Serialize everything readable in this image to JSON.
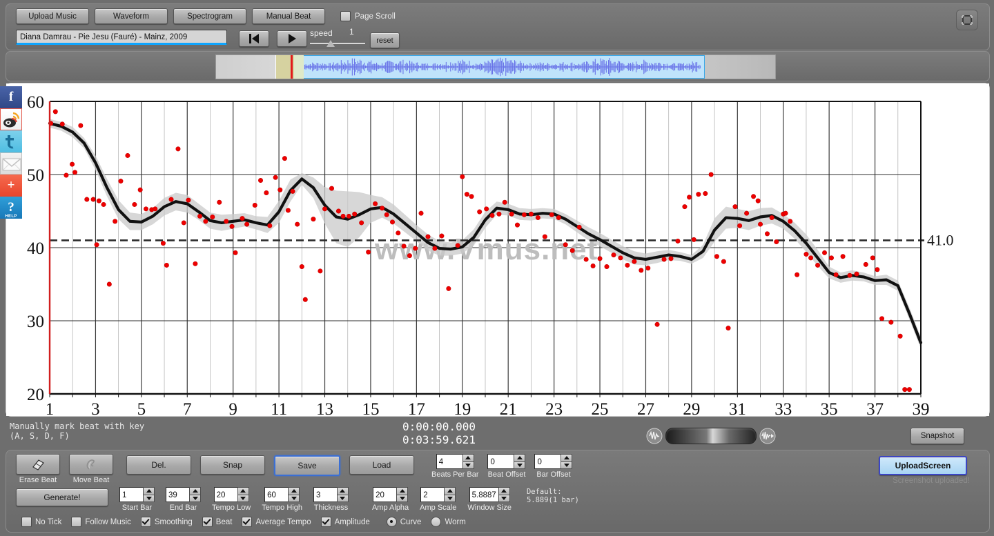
{
  "toolbar": {
    "buttons": [
      {
        "id": "upload-music",
        "label": "Upload Music"
      },
      {
        "id": "waveform",
        "label": "Waveform"
      },
      {
        "id": "spectrogram",
        "label": "Spectrogram"
      },
      {
        "id": "manual-beat",
        "label": "Manual Beat"
      }
    ],
    "page_scroll_label": "Page Scroll",
    "page_scroll_checked": false,
    "track_title": "Diana Damrau - Pie Jesu (Fauré) - Mainz, 2009",
    "speed_label": "speed",
    "speed_value": "1",
    "reset_label": "reset",
    "reload_icon": "reload-icon"
  },
  "social": [
    {
      "id": "facebook",
      "glyph": "f",
      "name": "facebook-icon"
    },
    {
      "id": "weibo",
      "glyph": "",
      "name": "weibo-icon"
    },
    {
      "id": "twitter",
      "glyph": "t",
      "name": "twitter-icon"
    },
    {
      "id": "email",
      "glyph": "",
      "name": "email-icon"
    },
    {
      "id": "share",
      "glyph": "+",
      "name": "plus-share-icon"
    },
    {
      "id": "help",
      "glyph": "?",
      "name": "help-icon",
      "caption": "HELP"
    }
  ],
  "chart_data": {
    "type": "line",
    "title": "",
    "xlabel": "",
    "ylabel": "",
    "watermark": "www.Vmus.net",
    "xlim": [
      1,
      39
    ],
    "ylim": [
      20,
      60
    ],
    "grid": true,
    "xticks": [
      1,
      3,
      5,
      7,
      9,
      11,
      13,
      15,
      17,
      19,
      21,
      23,
      25,
      27,
      29,
      31,
      33,
      35,
      37,
      39
    ],
    "yticks": [
      20,
      30,
      40,
      50,
      60
    ],
    "average_tempo": 41.0,
    "average_tempo_label": "41.0",
    "series": [
      {
        "name": "smoothed tempo curve",
        "color": "#111111",
        "x": [
          1,
          1.5,
          2,
          2.5,
          3,
          3.5,
          4,
          4.5,
          5,
          5.5,
          6,
          6.5,
          7,
          7.5,
          8,
          8.5,
          9,
          9.5,
          10,
          10.5,
          11,
          11.5,
          12,
          12.5,
          13,
          13.5,
          14,
          14.5,
          15,
          15.5,
          16,
          16.5,
          17,
          17.5,
          18,
          18.5,
          19,
          19.5,
          20,
          20.5,
          21,
          21.5,
          22,
          22.5,
          23,
          23.5,
          24,
          24.5,
          25,
          25.5,
          26,
          26.5,
          27,
          27.5,
          28,
          28.5,
          29,
          29.5,
          30,
          30.5,
          31,
          31.5,
          32,
          32.5,
          33,
          33.5,
          34,
          34.5,
          35,
          35.5,
          36,
          36.5,
          37,
          37.5,
          38,
          38.5,
          39
        ],
        "y": [
          57.0,
          56.6,
          55.8,
          54.3,
          51.6,
          48.2,
          45.2,
          43.6,
          43.5,
          44.3,
          45.6,
          46.3,
          46.0,
          44.9,
          43.7,
          43.4,
          43.6,
          43.8,
          43.4,
          43.1,
          44.9,
          47.8,
          49.4,
          48.2,
          45.8,
          44.2,
          43.9,
          44.5,
          45.3,
          45.5,
          44.6,
          43.3,
          42.0,
          40.7,
          39.9,
          39.8,
          40.1,
          41.4,
          43.8,
          45.4,
          45.2,
          44.6,
          44.5,
          44.7,
          44.6,
          43.9,
          42.9,
          41.9,
          41.1,
          40.2,
          39.3,
          38.6,
          38.4,
          38.7,
          39.0,
          38.8,
          38.4,
          39.5,
          42.4,
          44.1,
          44.0,
          43.7,
          44.2,
          44.4,
          43.6,
          42.3,
          40.6,
          38.6,
          36.6,
          35.9,
          36.2,
          36.0,
          35.5,
          35.6,
          34.8,
          31.0,
          27.0
        ]
      },
      {
        "name": "confidence band upper",
        "color": "#c9c9c9",
        "y": [
          57.6,
          57.2,
          56.5,
          55.0,
          52.6,
          49.4,
          46.5,
          44.8,
          44.6,
          45.4,
          46.8,
          47.5,
          47.2,
          46.0,
          44.8,
          44.5,
          44.6,
          44.7,
          44.3,
          44.2,
          46.4,
          49.3,
          50.2,
          49.6,
          48.3,
          47.8,
          47.7,
          47.6,
          47.2,
          46.9,
          45.9,
          44.5,
          43.1,
          41.8,
          40.9,
          40.7,
          41.0,
          42.5,
          44.9,
          46.3,
          46.0,
          45.4,
          45.3,
          45.4,
          45.3,
          44.6,
          43.7,
          42.8,
          42.0,
          41.1,
          40.2,
          39.5,
          39.2,
          39.5,
          39.7,
          39.4,
          39.0,
          40.4,
          44.0,
          45.6,
          45.3,
          45.0,
          45.4,
          45.5,
          44.6,
          43.4,
          41.8,
          39.7,
          37.4,
          36.6,
          36.9,
          36.6,
          36.1,
          36.3,
          35.5,
          31.8,
          27.8
        ]
      },
      {
        "name": "confidence band lower",
        "color": "#c9c9c9",
        "y": [
          56.4,
          56.0,
          55.1,
          53.6,
          50.6,
          47.0,
          43.9,
          42.4,
          42.4,
          43.2,
          44.4,
          45.1,
          44.8,
          43.8,
          42.6,
          42.3,
          42.6,
          42.9,
          42.5,
          42.0,
          43.4,
          46.3,
          48.6,
          46.8,
          43.3,
          40.6,
          40.1,
          41.4,
          43.4,
          44.1,
          43.3,
          42.1,
          40.9,
          39.6,
          38.9,
          38.9,
          39.2,
          40.3,
          42.7,
          44.5,
          44.4,
          43.8,
          43.7,
          44.0,
          43.9,
          43.2,
          42.1,
          41.0,
          40.2,
          39.3,
          38.4,
          37.7,
          37.6,
          37.9,
          38.3,
          38.2,
          37.8,
          38.6,
          40.8,
          42.6,
          42.7,
          42.4,
          43.0,
          43.3,
          42.6,
          41.2,
          39.4,
          37.5,
          35.8,
          35.2,
          35.5,
          35.4,
          34.9,
          34.9,
          34.1,
          30.2,
          26.2
        ]
      }
    ],
    "scatter": {
      "name": "beat tempo points",
      "color": "#ee0000",
      "points": [
        [
          1.05,
          57.0
        ],
        [
          1.25,
          58.6
        ],
        [
          1.55,
          56.9
        ],
        [
          1.72,
          49.9
        ],
        [
          1.98,
          51.4
        ],
        [
          2.1,
          50.3
        ],
        [
          2.35,
          56.7
        ],
        [
          2.62,
          46.6
        ],
        [
          2.9,
          46.6
        ],
        [
          3.05,
          40.4
        ],
        [
          3.15,
          46.4
        ],
        [
          3.35,
          45.9
        ],
        [
          3.6,
          35.0
        ],
        [
          3.85,
          43.6
        ],
        [
          4.1,
          49.1
        ],
        [
          4.4,
          52.6
        ],
        [
          4.7,
          45.9
        ],
        [
          4.95,
          47.9
        ],
        [
          5.2,
          45.3
        ],
        [
          5.45,
          45.2
        ],
        [
          5.6,
          45.3
        ],
        [
          5.95,
          40.6
        ],
        [
          6.1,
          37.6
        ],
        [
          6.3,
          46.6
        ],
        [
          6.6,
          53.5
        ],
        [
          6.85,
          43.4
        ],
        [
          7.05,
          46.5
        ],
        [
          7.35,
          37.8
        ],
        [
          7.55,
          44.3
        ],
        [
          7.8,
          43.6
        ],
        [
          8.1,
          44.2
        ],
        [
          8.4,
          46.2
        ],
        [
          8.7,
          43.6
        ],
        [
          8.95,
          42.9
        ],
        [
          9.1,
          39.3
        ],
        [
          9.4,
          44.0
        ],
        [
          9.6,
          43.2
        ],
        [
          9.95,
          45.8
        ],
        [
          10.2,
          49.2
        ],
        [
          10.45,
          47.5
        ],
        [
          10.6,
          43.0
        ],
        [
          10.85,
          49.6
        ],
        [
          11.05,
          47.9
        ],
        [
          11.25,
          52.2
        ],
        [
          11.4,
          45.1
        ],
        [
          11.6,
          47.7
        ],
        [
          11.8,
          43.2
        ],
        [
          12.0,
          37.4
        ],
        [
          12.15,
          32.9
        ],
        [
          12.5,
          43.9
        ],
        [
          12.8,
          36.8
        ],
        [
          13.0,
          45.3
        ],
        [
          13.3,
          48.1
        ],
        [
          13.6,
          45.0
        ],
        [
          13.8,
          44.3
        ],
        [
          14.05,
          44.3
        ],
        [
          14.3,
          44.6
        ],
        [
          14.6,
          43.4
        ],
        [
          14.9,
          39.4
        ],
        [
          15.2,
          46.0
        ],
        [
          15.5,
          45.4
        ],
        [
          15.7,
          44.5
        ],
        [
          15.95,
          43.5
        ],
        [
          16.2,
          42.0
        ],
        [
          16.45,
          40.2
        ],
        [
          16.7,
          38.9
        ],
        [
          16.95,
          39.9
        ],
        [
          17.2,
          44.7
        ],
        [
          17.5,
          41.5
        ],
        [
          17.8,
          39.9
        ],
        [
          18.1,
          41.6
        ],
        [
          18.4,
          34.4
        ],
        [
          18.8,
          40.3
        ],
        [
          19.0,
          49.7
        ],
        [
          19.2,
          47.3
        ],
        [
          19.4,
          47.0
        ],
        [
          19.75,
          44.9
        ],
        [
          20.05,
          45.3
        ],
        [
          20.3,
          44.4
        ],
        [
          20.6,
          44.6
        ],
        [
          20.85,
          46.2
        ],
        [
          21.15,
          44.6
        ],
        [
          21.4,
          43.1
        ],
        [
          21.7,
          44.5
        ],
        [
          22.0,
          44.6
        ],
        [
          22.3,
          44.1
        ],
        [
          22.6,
          41.5
        ],
        [
          22.9,
          44.5
        ],
        [
          23.2,
          44.1
        ],
        [
          23.5,
          40.4
        ],
        [
          23.8,
          39.6
        ],
        [
          24.1,
          42.8
        ],
        [
          24.4,
          38.4
        ],
        [
          24.7,
          37.5
        ],
        [
          25.0,
          38.5
        ],
        [
          25.3,
          37.4
        ],
        [
          25.6,
          39.0
        ],
        [
          25.9,
          38.6
        ],
        [
          26.2,
          37.6
        ],
        [
          26.5,
          38.1
        ],
        [
          26.8,
          36.9
        ],
        [
          27.1,
          37.2
        ],
        [
          27.5,
          29.5
        ],
        [
          27.8,
          38.4
        ],
        [
          28.1,
          38.5
        ],
        [
          28.4,
          40.9
        ],
        [
          28.7,
          45.6
        ],
        [
          28.9,
          46.9
        ],
        [
          29.1,
          41.1
        ],
        [
          29.3,
          47.3
        ],
        [
          29.6,
          47.4
        ],
        [
          29.85,
          50.0
        ],
        [
          30.1,
          38.8
        ],
        [
          30.4,
          38.1
        ],
        [
          30.6,
          29.0
        ],
        [
          30.9,
          45.6
        ],
        [
          31.1,
          43.0
        ],
        [
          31.4,
          44.7
        ],
        [
          31.7,
          47.0
        ],
        [
          31.9,
          46.4
        ],
        [
          32.0,
          43.2
        ],
        [
          32.3,
          41.9
        ],
        [
          32.5,
          44.1
        ],
        [
          32.7,
          40.8
        ],
        [
          33.0,
          44.6
        ],
        [
          33.1,
          44.7
        ],
        [
          33.3,
          43.6
        ],
        [
          33.6,
          36.3
        ],
        [
          34.0,
          39.1
        ],
        [
          34.2,
          38.6
        ],
        [
          34.5,
          37.6
        ],
        [
          34.8,
          39.3
        ],
        [
          35.1,
          38.6
        ],
        [
          35.3,
          36.3
        ],
        [
          35.6,
          38.8
        ],
        [
          35.9,
          36.2
        ],
        [
          36.2,
          36.4
        ],
        [
          36.6,
          37.7
        ],
        [
          36.9,
          38.6
        ],
        [
          37.1,
          37.0
        ],
        [
          37.3,
          30.3
        ],
        [
          37.7,
          29.8
        ],
        [
          38.1,
          27.9
        ],
        [
          38.3,
          20.6
        ],
        [
          38.5,
          20.6
        ]
      ]
    }
  },
  "status": {
    "hint_line1": "Manually mark beat with key",
    "hint_line2": "(A, S, D, F)",
    "time_current": "0:00:00.000",
    "time_total": "0:03:59.621",
    "snapshot_label": "Snapshot",
    "volume_name": "volume-slider"
  },
  "bottom": {
    "tools": [
      {
        "id": "erase-beat",
        "icon": "eraser-icon",
        "caption": "Erase Beat"
      },
      {
        "id": "move-beat",
        "icon": "hand-icon",
        "caption": "Move Beat"
      }
    ],
    "actions": [
      {
        "id": "del",
        "label": "Del.",
        "focus": false
      },
      {
        "id": "snap",
        "label": "Snap",
        "focus": false
      },
      {
        "id": "save",
        "label": "Save",
        "focus": true
      },
      {
        "id": "load",
        "label": "Load",
        "focus": false
      }
    ],
    "spinners_row1": [
      {
        "id": "beats-per-bar",
        "value": "4",
        "caption": "Beats Per Bar",
        "width": 38
      },
      {
        "id": "beat-offset",
        "value": "0",
        "caption": "Beat Offset",
        "width": 38
      },
      {
        "id": "bar-offset",
        "value": "0",
        "caption": "Bar Offset",
        "width": 38
      }
    ],
    "generate_label": "Generate!",
    "spinners_row2": [
      {
        "id": "start-bar",
        "value": "1",
        "caption": "Start Bar",
        "width": 34
      },
      {
        "id": "end-bar",
        "value": "39",
        "caption": "End Bar",
        "width": 34
      },
      {
        "id": "tempo-low",
        "value": "20",
        "caption": "Tempo Low",
        "width": 34
      },
      {
        "id": "tempo-high",
        "value": "60",
        "caption": "Tempo High",
        "width": 34
      },
      {
        "id": "thickness",
        "value": "3",
        "caption": "Thickness",
        "width": 34
      },
      {
        "id": "amp-alpha",
        "value": "20",
        "caption": "Amp Alpha",
        "width": 34
      },
      {
        "id": "amp-scale",
        "value": "2",
        "caption": "Amp Scale",
        "width": 34
      },
      {
        "id": "window-size",
        "value": "5.8887",
        "caption": "Window Size",
        "width": 42
      }
    ],
    "default_note_line1": "Default:",
    "default_note_line2": "5.889(1 bar)",
    "checkboxes": [
      {
        "id": "no-tick",
        "label": "No Tick",
        "checked": false
      },
      {
        "id": "follow-music",
        "label": "Follow Music",
        "checked": false
      },
      {
        "id": "smoothing",
        "label": "Smoothing",
        "checked": true
      },
      {
        "id": "beat",
        "label": "Beat",
        "checked": true
      },
      {
        "id": "average-tempo",
        "label": "Average Tempo",
        "checked": true
      },
      {
        "id": "amplitude",
        "label": "Amplitude",
        "checked": true
      }
    ],
    "radios": [
      {
        "id": "curve",
        "label": "Curve",
        "selected": true
      },
      {
        "id": "worm",
        "label": "Worm",
        "selected": false
      }
    ],
    "upload_screen_label": "UploadScreen",
    "upload_message": "Screenshot uploaded!"
  },
  "colors": {
    "accent_blue": "#0ea5ff",
    "scatter_red": "#ee0000",
    "curve_black": "#111111",
    "band_gray": "#c9c9c9",
    "panel_gray": "#6e6e6e"
  }
}
